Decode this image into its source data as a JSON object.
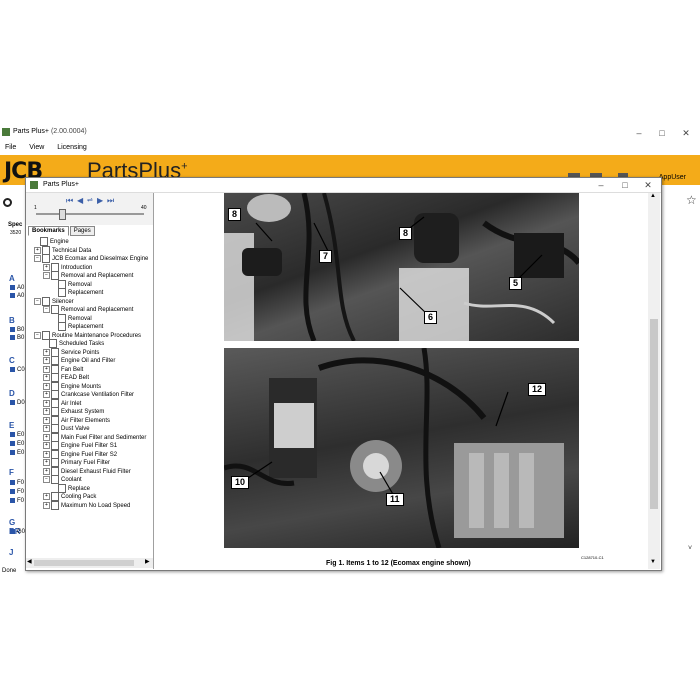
{
  "app": {
    "title": "Parts Plus+",
    "version": "(2.00.0004)"
  },
  "menu": [
    "File",
    "View",
    "Licensing"
  ],
  "brand": {
    "logo": "JCB",
    "product": "PartsPlus",
    "plus": "+",
    "color": "#f4ab19"
  },
  "user": "AppUser",
  "left_strip": {
    "spec_label": "Spec",
    "spec_value": "3520",
    "letters": [
      "A",
      "B",
      "C",
      "D",
      "E",
      "F",
      "G BR",
      "J"
    ],
    "items": [
      "A0",
      "A0",
      "B0",
      "B0",
      "C0",
      "D0",
      "E0",
      "E0",
      "E0",
      "F0",
      "F0",
      "F0",
      "G0"
    ]
  },
  "viewer": {
    "title": "Parts Plus+",
    "page_min": "1",
    "page_max": "40",
    "tabs": [
      "Bookmarks",
      "Pages"
    ],
    "tree": [
      {
        "label": "Engine",
        "level": 0,
        "exp": ""
      },
      {
        "label": "Technical Data",
        "level": 0,
        "exp": "+"
      },
      {
        "label": "JCB Ecomax and Dieselmax Engine",
        "level": 0,
        "exp": "-"
      },
      {
        "label": "Introduction",
        "level": 1,
        "exp": "+"
      },
      {
        "label": "Removal and Replacement",
        "level": 1,
        "exp": "-"
      },
      {
        "label": "Removal",
        "level": 2,
        "exp": ""
      },
      {
        "label": "Replacement",
        "level": 2,
        "exp": ""
      },
      {
        "label": "Silencer",
        "level": 0,
        "exp": "-"
      },
      {
        "label": "Removal and Replacement",
        "level": 1,
        "exp": "-"
      },
      {
        "label": "Removal",
        "level": 2,
        "exp": ""
      },
      {
        "label": "Replacement",
        "level": 2,
        "exp": ""
      },
      {
        "label": "Routine Maintenance Procedures",
        "level": 0,
        "exp": "-"
      },
      {
        "label": "Scheduled Tasks",
        "level": 1,
        "exp": ""
      },
      {
        "label": "Service Points",
        "level": 1,
        "exp": "+"
      },
      {
        "label": "Engine Oil and Filter",
        "level": 1,
        "exp": "+"
      },
      {
        "label": "Fan Belt",
        "level": 1,
        "exp": "+"
      },
      {
        "label": "FEAD Belt",
        "level": 1,
        "exp": "+"
      },
      {
        "label": "Engine Mounts",
        "level": 1,
        "exp": "+"
      },
      {
        "label": "Crankcase Ventilation Filter",
        "level": 1,
        "exp": "+"
      },
      {
        "label": "Air Inlet",
        "level": 1,
        "exp": "+"
      },
      {
        "label": "Exhaust System",
        "level": 1,
        "exp": "+"
      },
      {
        "label": "Air Filter Elements",
        "level": 1,
        "exp": "+"
      },
      {
        "label": "Dust Valve",
        "level": 1,
        "exp": "+"
      },
      {
        "label": "Main Fuel Filter and Sedimenter",
        "level": 1,
        "exp": "+"
      },
      {
        "label": "Engine Fuel Filter S1",
        "level": 1,
        "exp": "+"
      },
      {
        "label": "Engine Fuel Filter S2",
        "level": 1,
        "exp": "+"
      },
      {
        "label": "Primary Fuel Filter",
        "level": 1,
        "exp": "+"
      },
      {
        "label": "Diesel Exhaust Fluid Filter",
        "level": 1,
        "exp": "+"
      },
      {
        "label": "Coolant",
        "level": 1,
        "exp": "-"
      },
      {
        "label": "Replace",
        "level": 2,
        "exp": ""
      },
      {
        "label": "Cooling Pack",
        "level": 1,
        "exp": "+"
      },
      {
        "label": "Maximum No Load Speed",
        "level": 1,
        "exp": "+"
      }
    ],
    "callouts_top": [
      "8",
      "7",
      "8",
      "5",
      "6"
    ],
    "callouts_bottom": [
      "12",
      "10",
      "11"
    ],
    "caption": "Fig 1. Items 1 to 12 (Ecomax engine shown)",
    "figure_code": "C128710-C1"
  },
  "status": "Done"
}
